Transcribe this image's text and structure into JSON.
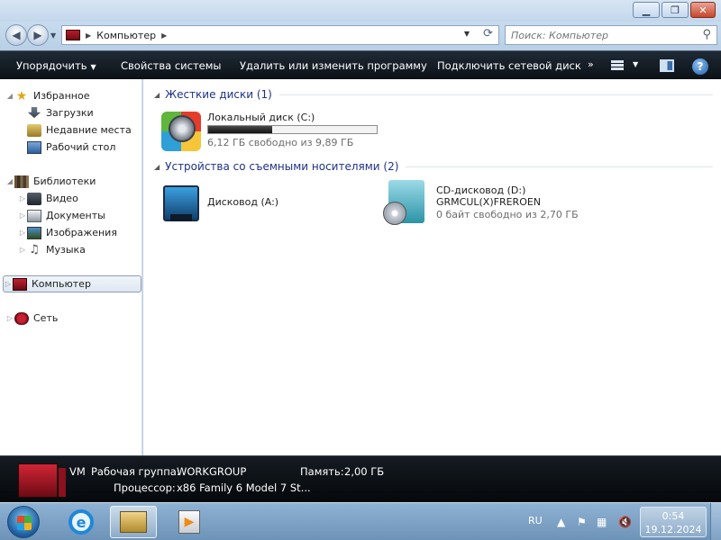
{
  "window": {
    "min_glyph": "▁",
    "max_glyph": "❐",
    "close_glyph": "✕"
  },
  "address": {
    "location": "Компьютер",
    "search_placeholder": "Поиск: Компьютер"
  },
  "toolbar": {
    "organize": "Упорядочить",
    "system_properties": "Свойства системы",
    "uninstall": "Удалить или изменить программу",
    "map_drive": "Подключить сетевой диск",
    "more": "»",
    "help": "?"
  },
  "nav": {
    "favorites": "Избранное",
    "downloads": "Загрузки",
    "recent": "Недавние места",
    "desktop": "Рабочий стол",
    "libraries": "Библиотеки",
    "video": "Видео",
    "documents": "Документы",
    "images": "Изображения",
    "music": "Музыка",
    "computer": "Компьютер",
    "network": "Сеть"
  },
  "content": {
    "hard_drives_header": "Жесткие диски (1)",
    "removable_header": "Устройства со съемными носителями (2)",
    "local_disk": {
      "name": "Локальный диск (C:)",
      "free": "6,12 ГБ свободно из 9,89 ГБ",
      "used_fraction": 0.381
    },
    "floppy": {
      "name": "Дисковод (A:)"
    },
    "cd": {
      "name": "CD-дисковод (D:)",
      "label": "GRMCUL(X)FREROEN",
      "free": "0 байт свободно из 2,70 ГБ"
    }
  },
  "details": {
    "name": "VM",
    "workgroup_label": "Рабочая группа:",
    "workgroup": "WORKGROUP",
    "memory_label": "Память:",
    "memory": "2,00 ГБ",
    "cpu_label": "Процессор:",
    "cpu": "x86 Family 6 Model 7 St..."
  },
  "taskbar": {
    "language": "RU",
    "time": "0:54",
    "date": "19.12.2024"
  }
}
